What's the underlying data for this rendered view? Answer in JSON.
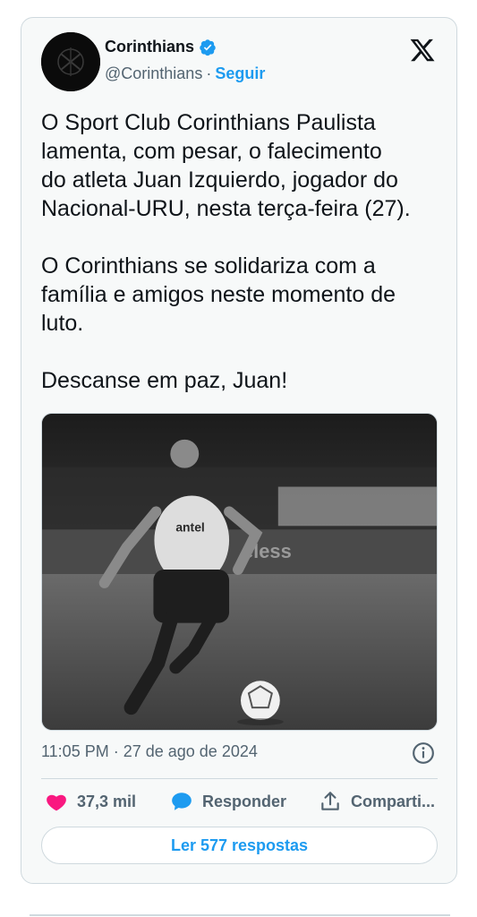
{
  "author": {
    "display_name": "Corinthians",
    "handle": "@Corinthians",
    "separator": "·",
    "follow_label": "Seguir",
    "verified": true
  },
  "tweet": {
    "text": "O Sport Club Corinthians Paulista\nlamenta, com pesar, o falecimento\ndo atleta Juan Izquierdo, jogador do\nNacional-URU, nesta terça-feira (27).\n\nO Corinthians se solidariza com a\nfamília e amigos neste momento de\nluto.\n\nDescanse em paz, Juan!",
    "image_alt": "Black and white photo of a football player dribbling a ball"
  },
  "meta": {
    "time": "11:05 PM",
    "separator": "·",
    "date": "27 de ago de 2024"
  },
  "actions": {
    "like_count": "37,3 mil",
    "reply_label": "Responder",
    "share_label": "Comparti..."
  },
  "read_replies_label": "Ler 577 respostas",
  "colors": {
    "accent": "#1d9bf0",
    "like": "#f91880",
    "text": "#0f1419",
    "muted": "#536471",
    "card_bg": "#f7f9f9",
    "border": "#cfd9de"
  }
}
